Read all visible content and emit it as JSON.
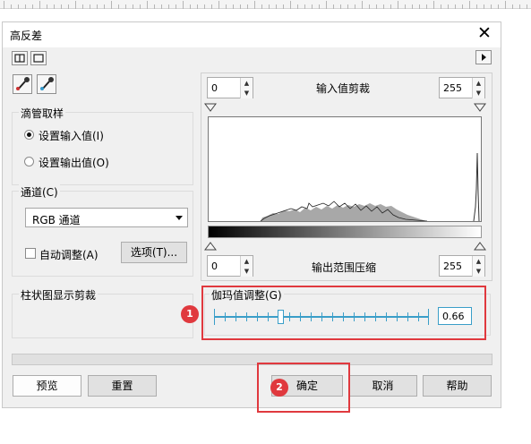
{
  "dialog": {
    "title": "高反差",
    "close_icon": "close-icon"
  },
  "toolbar": {
    "split_view_icon": "split-view-icon",
    "single_view_icon": "single-view-icon",
    "expand_icon": "play-right-icon"
  },
  "tools": {
    "eyedropper_in_icon": "eyedropper-input-icon",
    "eyedropper_out_icon": "eyedropper-output-icon"
  },
  "sampling": {
    "label": "滴管取样",
    "options": [
      {
        "label": "设置输入值(I)",
        "selected": true
      },
      {
        "label": "设置输出值(O)",
        "selected": false
      }
    ]
  },
  "channel": {
    "label": "通道(C)",
    "selected": "RGB 通道",
    "auto_adjust_label": "自动调整(A)",
    "auto_adjust_checked": false,
    "options_button": "选项(T)..."
  },
  "histogram_clip": {
    "label": "柱状图显示剪裁"
  },
  "input_clip": {
    "low": "0",
    "label": "输入值剪裁",
    "high": "255"
  },
  "output_range": {
    "low": "0",
    "label": "输出范围压缩",
    "high": "255"
  },
  "gamma": {
    "label": "伽玛值调整(G)",
    "value": "0.66",
    "slider_fraction": 0.31
  },
  "buttons": {
    "preview": "预览",
    "reset": "重置",
    "ok": "确定",
    "cancel": "取消",
    "help": "帮助"
  },
  "annotations": {
    "marker_1": "1",
    "marker_2": "2",
    "color": "#e0393e"
  },
  "colors": {
    "dialog_bg": "#f0f0f0",
    "slider_accent": "#3a9ec8",
    "histogram_fill": "#a8a8a8"
  }
}
